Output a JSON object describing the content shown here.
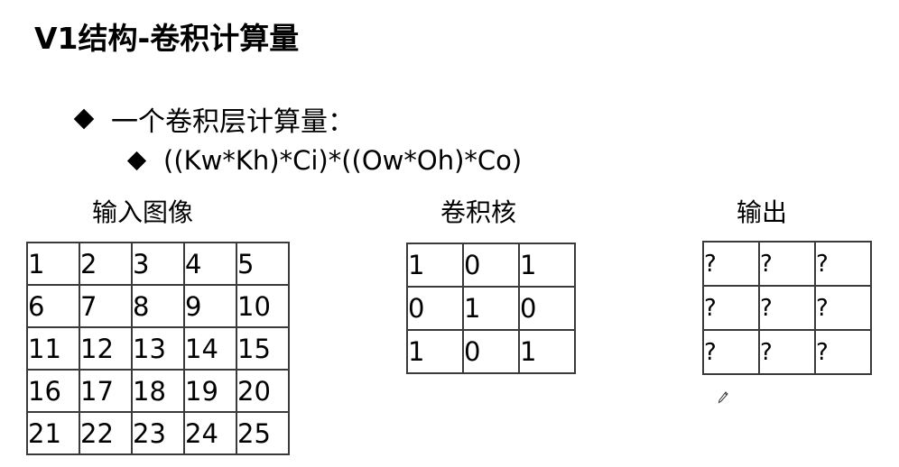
{
  "slide": {
    "title": "V1结构-卷积计算量",
    "bullet1": "一个卷积层计算量：",
    "bullet2": "((Kw*Kh)*Ci)*((Ow*Oh)*Co)"
  },
  "input_image": {
    "caption": "输入图像",
    "rows": [
      [
        "1",
        "2",
        "3",
        "4",
        "5"
      ],
      [
        "6",
        "7",
        "8",
        "9",
        "10"
      ],
      [
        "11",
        "12",
        "13",
        "14",
        "15"
      ],
      [
        "16",
        "17",
        "18",
        "19",
        "20"
      ],
      [
        "21",
        "22",
        "23",
        "24",
        "25"
      ]
    ]
  },
  "kernel": {
    "caption": "卷积核",
    "rows": [
      [
        "1",
        "0",
        "1"
      ],
      [
        "0",
        "1",
        "0"
      ],
      [
        "1",
        "0",
        "1"
      ]
    ]
  },
  "output": {
    "caption": "输出",
    "rows": [
      [
        "?",
        "?",
        "?"
      ],
      [
        "?",
        "?",
        "?"
      ],
      [
        "?",
        "?",
        "?"
      ]
    ]
  },
  "icons": {
    "cursor": "pencil-icon"
  }
}
